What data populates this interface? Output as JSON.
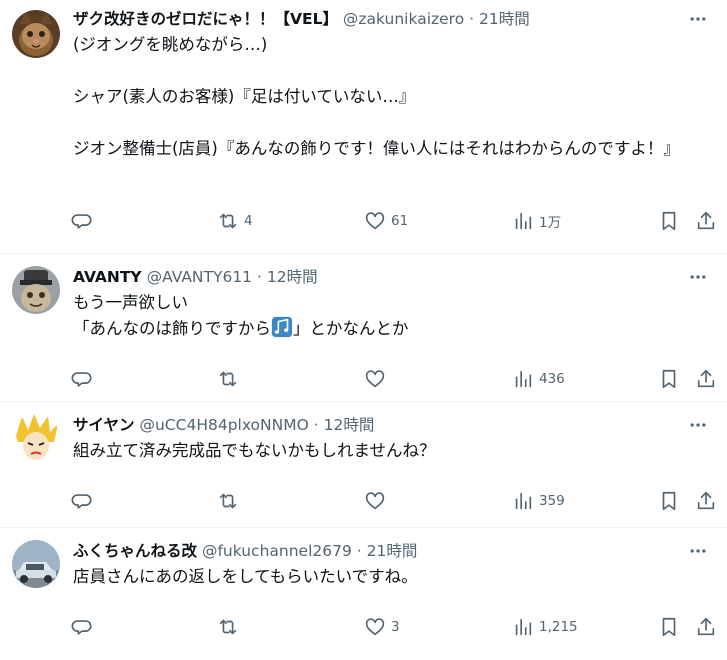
{
  "tweets": [
    {
      "name": "ザク改好きのゼロだにゃ！！【VEL】",
      "handle": "@zakunikaizero",
      "sep": "·",
      "time": "21時間",
      "text": "(ジオングを眺めながら…)\n\nシャア(素人のお客様)『足は付いていない…』\n\nジオン整備士(店員)『あんなの飾りです！偉い人にはそれはわからんのですよ！』",
      "retweets": "4",
      "likes": "61",
      "views": "1万",
      "avatar_colors": [
        "#6b4a2e",
        "#c79a6a",
        "#2d2116"
      ]
    },
    {
      "name": "AVANTY",
      "handle": "@AVANTY611",
      "sep": "·",
      "time": "12時間",
      "text_line1": "もう一声欲しい",
      "text_line2_a": "「あんなのは飾りですから",
      "text_line2_b": "」とかなんとか",
      "emoji": "musical-notes",
      "retweets": "",
      "likes": "",
      "views": "436",
      "avatar_colors": [
        "#8a8f92",
        "#3a3a3a",
        "#c8b79a"
      ]
    },
    {
      "name": "サイヤン",
      "handle": "@uCC4H84plxoNNMO",
      "sep": "·",
      "time": "12時間",
      "text": "組み立て済み完成品でもないかもしれませんね？",
      "retweets": "",
      "likes": "",
      "views": "359",
      "avatar_colors": [
        "#f2c230",
        "#f7f1dc",
        "#d9342b"
      ]
    },
    {
      "name": "ふくちゃんねる改",
      "handle": "@fukuchannel2679",
      "sep": "·",
      "time": "21時間",
      "text": "店員さんにあの返しをしてもらいたいですね。",
      "retweets": "",
      "likes": "3",
      "views": "1,215",
      "avatar_colors": [
        "#6f8aa3",
        "#d6dde3",
        "#2c2f33"
      ]
    }
  ],
  "colors": {
    "text": "#0f1419",
    "secondary": "#536471",
    "border": "#eff3f4",
    "emoji_blue": "#3b88c3"
  }
}
